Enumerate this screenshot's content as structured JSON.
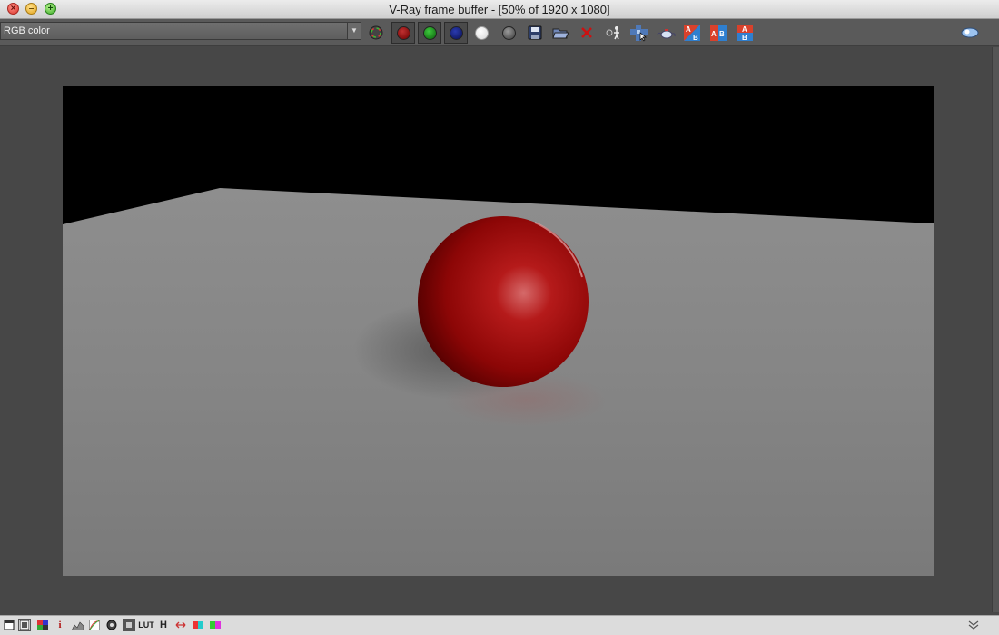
{
  "window": {
    "title": "V-Ray frame buffer - [50% of 1920 x 1080]"
  },
  "toolbar": {
    "channel_select": {
      "value": "RGB color"
    },
    "buttons": [
      "display-correction-icon",
      "red-channel-icon",
      "green-channel-icon",
      "blue-channel-icon",
      "white-display-icon",
      "alpha-channel-icon",
      "save-icon",
      "open-folder-icon",
      "clear-image-icon",
      "track-mouse-icon",
      "region-render-icon",
      "teapot-render-icon",
      "compare-ab-diagonal-icon",
      "compare-ab-horizontal-icon",
      "compare-ab-vertical-icon",
      "stereo-glasses-icon"
    ]
  },
  "statusbar": {
    "i_label": "i",
    "lut_label": "LUT",
    "h_label": "H"
  },
  "colors": {
    "background": "#474747",
    "sphere": "#b01212",
    "floor": "#8a8a8a"
  }
}
